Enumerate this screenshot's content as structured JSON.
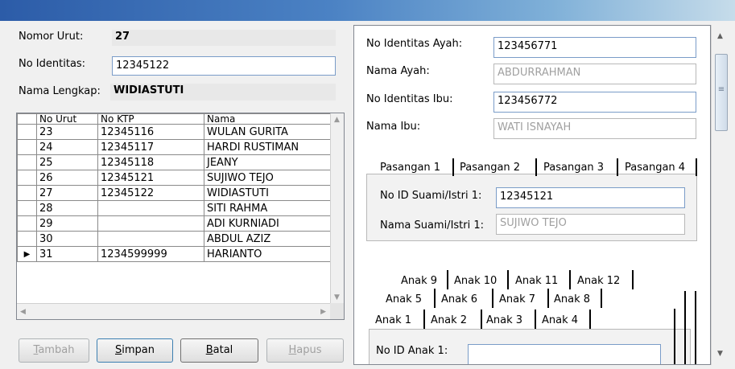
{
  "left": {
    "nomor_urut_label": "Nomor Urut:",
    "nomor_urut_value": "27",
    "no_identitas_label": "No Identitas:",
    "no_identitas_value": "12345122",
    "nama_lengkap_label": "Nama Lengkap:",
    "nama_lengkap_value": "WIDIASTUTI"
  },
  "grid": {
    "headers": [
      "No Urut",
      "No KTP",
      "Nama"
    ],
    "rows": [
      {
        "no": "23",
        "ktp": "12345116",
        "nama": "WULAN GURITA"
      },
      {
        "no": "24",
        "ktp": "12345117",
        "nama": "HARDI RUSTIMAN"
      },
      {
        "no": "25",
        "ktp": "12345118",
        "nama": "JEANY"
      },
      {
        "no": "26",
        "ktp": "12345121",
        "nama": "SUJIWO TEJO"
      },
      {
        "no": "27",
        "ktp": "12345122",
        "nama": "WIDIASTUTI"
      },
      {
        "no": "28",
        "ktp": "",
        "nama": "SITI RAHMA"
      },
      {
        "no": "29",
        "ktp": "",
        "nama": "ADI KURNIADI"
      },
      {
        "no": "30",
        "ktp": "",
        "nama": "ABDUL AZIZ"
      },
      {
        "no": "31",
        "ktp": "1234599999",
        "nama": "HARIANTO"
      }
    ],
    "current_row_marker": "▶"
  },
  "buttons": {
    "tambah": {
      "accel": "T",
      "rest": "ambah"
    },
    "simpan": {
      "accel": "S",
      "rest": "impan"
    },
    "batal": {
      "accel": "B",
      "rest": "atal"
    },
    "hapus": {
      "accel": "H",
      "rest": "apus"
    }
  },
  "right": {
    "id_ayah_label": "No Identitas Ayah:",
    "id_ayah_value": "123456771",
    "nama_ayah_label": "Nama Ayah:",
    "nama_ayah_value": "ABDURRAHMAN",
    "id_ibu_label": "No Identitas Ibu:",
    "id_ibu_value": "123456772",
    "nama_ibu_label": "Nama Ibu:",
    "nama_ibu_value": "WATI ISNAYAH"
  },
  "pasangan": {
    "tabs": [
      "Pasangan 1",
      "Pasangan 2",
      "Pasangan 3",
      "Pasangan 4"
    ],
    "id_label": "No ID Suami/Istri 1:",
    "id_value": "12345121",
    "nama_label": "Nama Suami/Istri 1:",
    "nama_value": "SUJIWO TEJO"
  },
  "anak": {
    "row3": [
      "Anak 9",
      "Anak 10",
      "Anak 11",
      "Anak 12"
    ],
    "row2": [
      "Anak 5",
      "Anak 6",
      "Anak 7",
      "Anak 8"
    ],
    "row1": [
      "Anak 1",
      "Anak 2",
      "Anak 3",
      "Anak 4"
    ],
    "id_label": "No ID Anak 1:",
    "id_value": ""
  },
  "colors": {
    "title_gradient_start": "#2c5ca8",
    "title_gradient_end": "#c6dcea",
    "input_border": "#7a9cc8",
    "disabled_text": "#a0a0a0"
  }
}
